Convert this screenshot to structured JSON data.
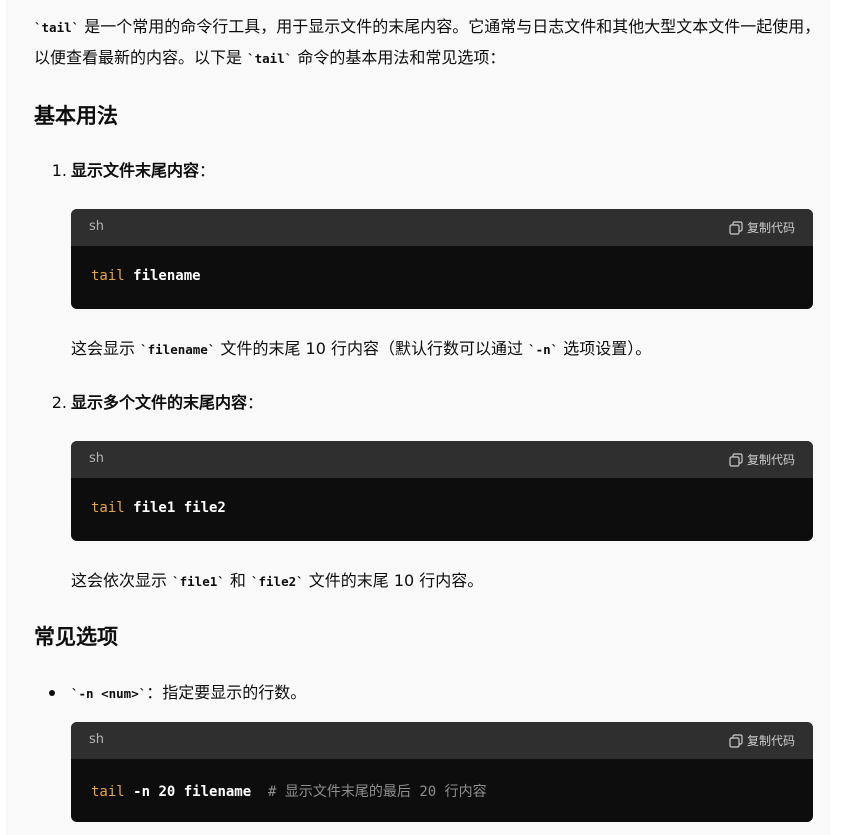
{
  "intro": {
    "part1": "是一个常用的命令行工具，用于显示文件的末尾内容。它通常与日志文件和其他大型文本文",
    "part2": "件一起使用，以便查看最新的内容。以下是 ",
    "part3": " 命令的基本用法和常见选项：",
    "code_tail": "`tail`"
  },
  "sections": {
    "basic": "基本用法",
    "options": "常见选项"
  },
  "item1": {
    "num": "1.",
    "title": "显示文件末尾内容",
    "colon": "：",
    "code": {
      "lang": "sh",
      "copy": "复制代码",
      "cmd": "tail",
      "rest": " filename"
    },
    "desc_pre": "这会显示 ",
    "desc_code": "`filename`",
    "desc_mid": " 文件的末尾 10 行内容（默认行数可以通过 ",
    "desc_code2": "`-n`",
    "desc_post": " 选项设置）。"
  },
  "item2": {
    "num": "2.",
    "title": "显示多个文件的末尾内容",
    "colon": "：",
    "code": {
      "lang": "sh",
      "copy": "复制代码",
      "cmd": "tail",
      "rest": " file1 file2"
    },
    "desc_pre": "这会依次显示 ",
    "desc_code": "`file1`",
    "desc_mid": " 和 ",
    "desc_code2": "`file2`",
    "desc_post": " 文件的末尾 10 行内容。"
  },
  "item3": {
    "code_label": "`-n <num>`",
    "text": "：指定要显示的行数。",
    "code": {
      "lang": "sh",
      "copy": "复制代码",
      "cmd": "tail",
      "flag": " -n ",
      "n": "20",
      "file": " filename  ",
      "comment_a": "# 显示文件末尾的最后 ",
      "comment_n": "20",
      "comment_b": " 行内容"
    }
  },
  "colors": {
    "code_bg": "#0d0d0d",
    "code_bar": "#2f2f2f",
    "keyword": "#e7a34b",
    "panel": "#f9f9f9"
  }
}
